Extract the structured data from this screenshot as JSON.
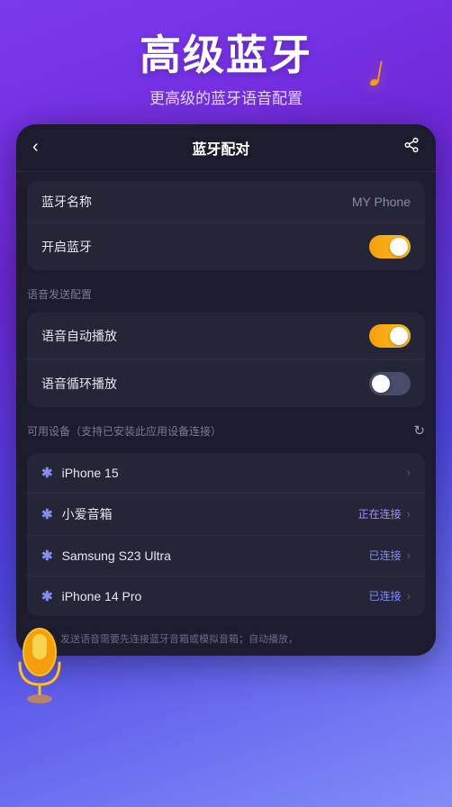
{
  "hero": {
    "title": "高级蓝牙",
    "subtitle": "更高级的蓝牙语音配置"
  },
  "header": {
    "title": "蓝牙配对",
    "back_label": "‹",
    "share_label": "⎋"
  },
  "settings": {
    "bluetooth_name_label": "蓝牙名称",
    "bluetooth_name_value": "MY Phone",
    "enable_bluetooth_label": "开启蓝牙",
    "enable_bluetooth_on": true
  },
  "voice_section": {
    "section_label": "语音发送配置",
    "auto_play_label": "语音自动播放",
    "auto_play_on": true,
    "loop_play_label": "语音循环播放",
    "loop_play_on": false
  },
  "devices_section": {
    "section_label": "可用设备（支持已安装此应用设备连接）",
    "devices": [
      {
        "name": "iPhone 15",
        "status": "",
        "connected": false
      },
      {
        "name": "小爱音箱",
        "status": "正在连接",
        "connected": false
      },
      {
        "name": "Samsung  S23 Ultra",
        "status": "已连接",
        "connected": true
      },
      {
        "name": "iPhone 14 Pro",
        "status": "已连接",
        "connected": true
      }
    ]
  },
  "footer": {
    "note": "说明：发送语音需要先连接蓝牙音箱或模拟音箱；自动播放，"
  },
  "icons": {
    "music_note": "♪",
    "back": "‹",
    "share": "⤴",
    "refresh": "↻",
    "bluetooth": "Ƀ",
    "chevron": "›"
  }
}
